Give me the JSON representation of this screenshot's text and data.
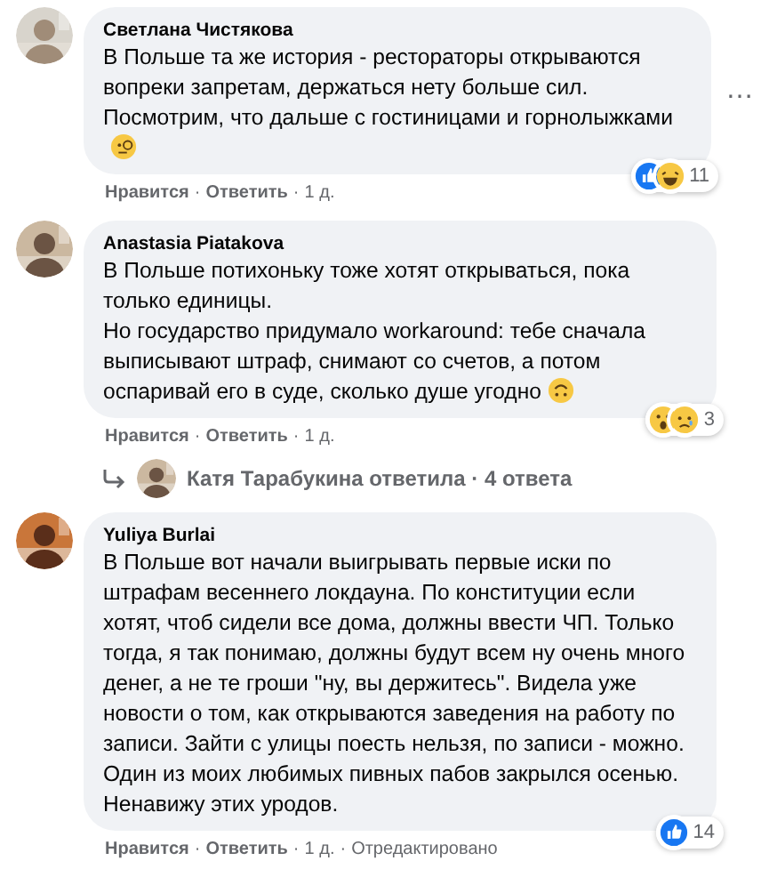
{
  "separator": "·",
  "comments": [
    {
      "author": "Светлана Чистякова",
      "paragraphs": [
        "В Польше та же история - рестораторы открываются вопреки запретам, держаться нету больше сил. Посмотрим, что дальше с гостиницами и горнолыжками"
      ],
      "emoji": {
        "kind": "monocle"
      },
      "menu": "…",
      "reactions": {
        "icons": [
          {
            "kind": "like"
          },
          {
            "kind": "haha"
          }
        ],
        "count": "11"
      },
      "actions": [
        "Нравится",
        "Ответить"
      ],
      "time": "1 д."
    },
    {
      "author": "Anastasia Piatakova",
      "paragraphs": [
        "В Польше потихоньку тоже хотят открываться, пока только единицы.",
        "Но государство придумало workaround: тебе сначала выписывают штраф, снимают со счетов, а потом оспаривай его в суде, сколько душе угодно"
      ],
      "emoji": {
        "kind": "upside-down"
      },
      "reactions": {
        "icons": [
          {
            "kind": "wow"
          },
          {
            "kind": "sad"
          }
        ],
        "count": "3"
      },
      "actions": [
        "Нравится",
        "Ответить"
      ],
      "time": "1 д.",
      "replies": {
        "text": "Катя Тарабукина ответила · 4 ответа"
      }
    },
    {
      "author": "Yuliya Burlai",
      "paragraphs": [
        "В Польше вот начали выигрывать первые иски по штрафам весеннего локдауна. По конституции если хотят, чтоб сидели все дома, должны ввести ЧП. Только тогда, я так понимаю, должны будут всем ну очень много денег, а не те гроши \"ну, вы держитесь\". Видела уже новости о том, как открываются заведения на работу по записи. Зайти с улицы поесть нельзя, по записи - можно. Один из моих любимых пивных пабов закрылся осенью. Ненавижу этих уродов."
      ],
      "reactions": {
        "icons": [
          {
            "kind": "like"
          }
        ],
        "count": "14"
      },
      "actions": [
        "Нравится",
        "Ответить"
      ],
      "time": "1 д.",
      "edited": "Отредактировано"
    }
  ]
}
